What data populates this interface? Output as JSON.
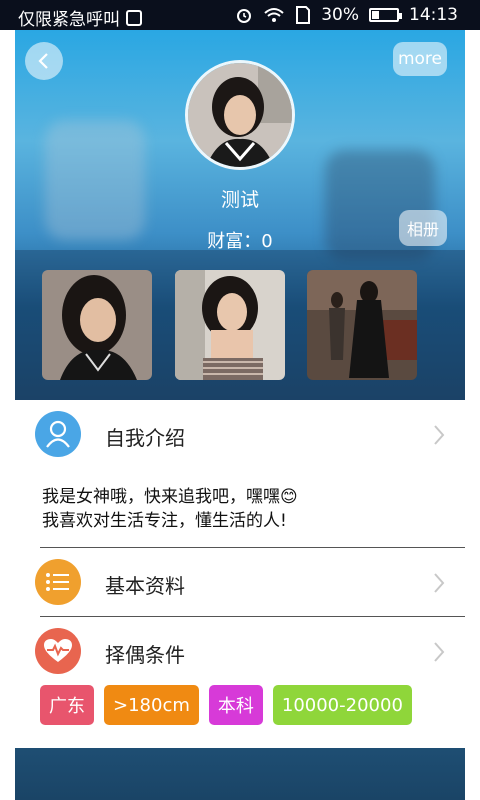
{
  "status_bar": {
    "carrier": "仅限紧急呼叫",
    "battery": "30%",
    "battery_level": 0.3,
    "time": "14:13",
    "icons": [
      "sim-icon",
      "alarm-icon",
      "wifi-icon",
      "sim-card-icon",
      "battery-icon"
    ]
  },
  "header": {
    "more_label": "more",
    "name": "测试",
    "wealth": "财富：0",
    "album_label": "相册"
  },
  "sections": {
    "intro_title": "自我介绍",
    "intro_lines": [
      "我是女神哦，快来追我吧，嘿嘿😊",
      "我喜欢对生活专注，懂生活的人!"
    ],
    "basic_title": "基本资料",
    "criteria_title": "择偶条件"
  },
  "tags": [
    {
      "text": "广东",
      "color": "#e8556d"
    },
    {
      "text": ">180cm",
      "color": "#f08a12"
    },
    {
      "text": "本科",
      "color": "#d73ad8"
    },
    {
      "text": "10000-20000",
      "color": "#8fd63a"
    }
  ],
  "colors": {
    "intro_icon": "#4aa6e6",
    "basic_icon": "#f0a02e",
    "criteria_icon": "#e8654f"
  }
}
